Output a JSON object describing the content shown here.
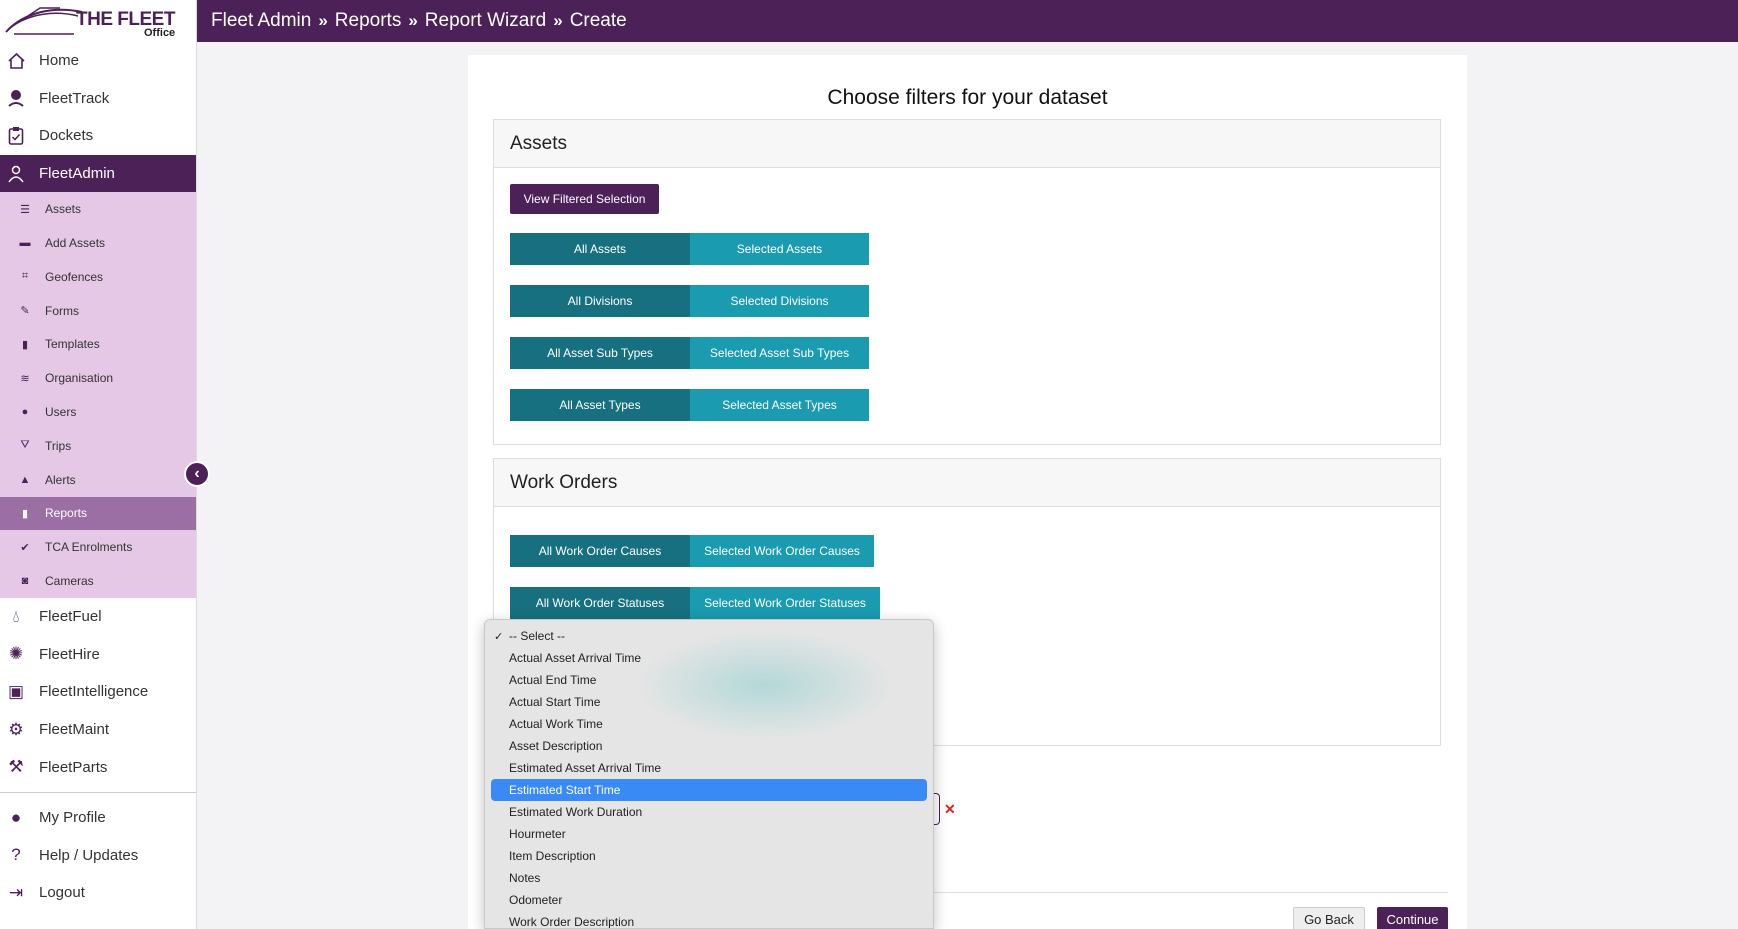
{
  "brand": {
    "title": "THE FLEET",
    "subtitle": "Office"
  },
  "breadcrumb": [
    "Fleet Admin",
    "Reports",
    "Report Wizard",
    "Create"
  ],
  "breadcrumb_sep": "»",
  "nav_top": [
    {
      "label": "Home",
      "icon": "home-icon"
    },
    {
      "label": "FleetTrack",
      "icon": "location-pin-icon"
    },
    {
      "label": "Dockets",
      "icon": "clipboard-icon"
    },
    {
      "label": "FleetAdmin",
      "icon": "admin-users-icon",
      "active": true
    }
  ],
  "subnav": [
    {
      "label": "Assets",
      "icon": "list-icon"
    },
    {
      "label": "Add Assets",
      "icon": "folder-plus-icon"
    },
    {
      "label": "Geofences",
      "icon": "geofence-icon"
    },
    {
      "label": "Forms",
      "icon": "edit-icon"
    },
    {
      "label": "Templates",
      "icon": "file-icon"
    },
    {
      "label": "Organisation",
      "icon": "layers-icon"
    },
    {
      "label": "Users",
      "icon": "user-icon"
    },
    {
      "label": "Trips",
      "icon": "road-icon"
    },
    {
      "label": "Alerts",
      "icon": "warning-icon"
    },
    {
      "label": "Reports",
      "icon": "clipboard-icon",
      "active": true
    },
    {
      "label": "TCA Enrolments",
      "icon": "check-circle-icon"
    },
    {
      "label": "Cameras",
      "icon": "camera-icon"
    }
  ],
  "nav_apps": [
    {
      "label": "FleetFuel",
      "icon": "fuel-drop-icon"
    },
    {
      "label": "FleetHire",
      "icon": "hire-icon"
    },
    {
      "label": "FleetIntelligence",
      "icon": "monitor-chart-icon"
    },
    {
      "label": "FleetMaint",
      "icon": "gears-icon"
    },
    {
      "label": "FleetParts",
      "icon": "engine-icon"
    }
  ],
  "nav_bottom": [
    {
      "label": "My Profile",
      "icon": "user-icon"
    },
    {
      "label": "Help / Updates",
      "icon": "question-icon"
    },
    {
      "label": "Logout",
      "icon": "logout-icon"
    }
  ],
  "main": {
    "title": "Choose filters for your dataset",
    "assets_panel": {
      "heading": "Assets",
      "view_button": "View Filtered Selection",
      "toggles": [
        {
          "a": "All Assets",
          "b": "Selected Assets"
        },
        {
          "a": "All Divisions",
          "b": "Selected Divisions"
        },
        {
          "a": "All Asset Sub Types",
          "b": "Selected Asset Sub Types"
        },
        {
          "a": "All Asset Types",
          "b": "Selected Asset Types"
        }
      ]
    },
    "work_orders_panel": {
      "heading": "Work Orders",
      "toggles": [
        {
          "a": "All Work Order Causes",
          "b": "Selected Work Order Causes"
        },
        {
          "a": "All Work Order Statuses",
          "b": "Selected Work Order Statuses"
        }
      ]
    },
    "dropdown": {
      "options": [
        "-- Select --",
        "Actual Asset Arrival Time",
        "Actual End Time",
        "Actual Start Time",
        "Actual Work Time",
        "Asset Description",
        "Estimated Asset Arrival Time",
        "Estimated Start Time",
        "Estimated Work Duration",
        "Hourmeter",
        "Item Description",
        "Notes",
        "Odometer",
        "Work Order Description"
      ],
      "checked": "-- Select --",
      "highlighted": "Estimated Start Time"
    },
    "remove_label": "✕",
    "go_back": "Go Back",
    "continue": "Continue"
  }
}
